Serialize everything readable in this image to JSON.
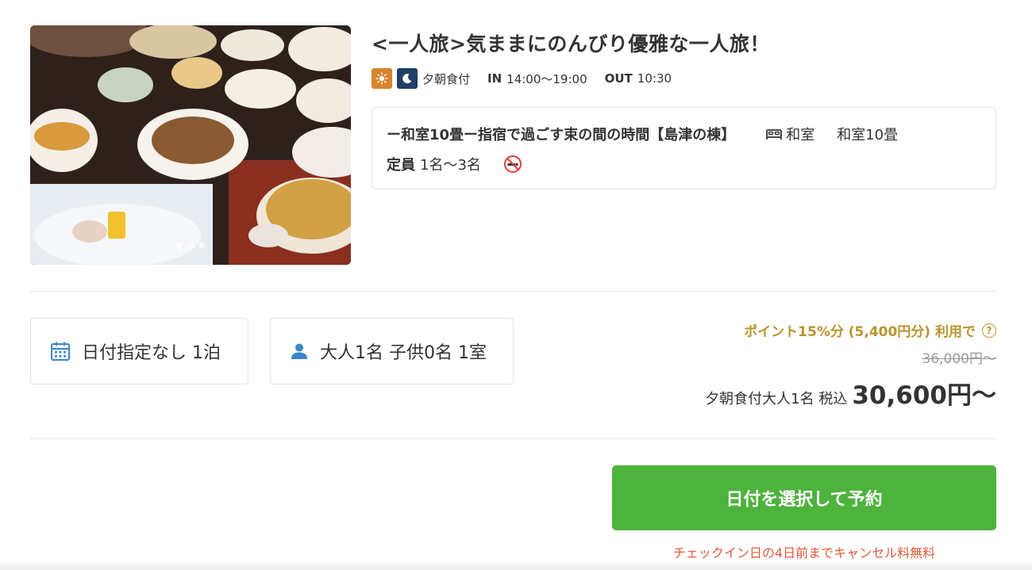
{
  "plan": {
    "title": "<一人旅>気ままにのんびり優雅な一人旅！",
    "image_alt": "会席料理の写真",
    "carousel": {
      "total": 3,
      "active": 1
    },
    "meal_label": "夕朝食付",
    "checkin_key": "IN",
    "checkin_val": "14:00〜19:00",
    "checkout_key": "OUT",
    "checkout_val": "10:30"
  },
  "room": {
    "name": "ー和室10畳ー指宿で過ごす束の間の時間【島津の棟】",
    "type": "和室",
    "size": "和室10畳",
    "capacity_label": "定員",
    "capacity_val": "1名〜3名",
    "smoking_icon": "no-smoking-icon"
  },
  "search": {
    "date_label": "日付指定なし 1泊",
    "guest_label": "大人1名 子供0名 1室"
  },
  "price": {
    "points_text": "ポイント15%分 (5,400円分) 利用で",
    "help_mark": "?",
    "original": "36,000円〜",
    "desc": "夕朝食付大人1名 税込",
    "main": "30,600円〜"
  },
  "cta": {
    "reserve_label": "日付を選択して予約",
    "cancel_note": "チェックイン日の4日前までキャンセル料無料"
  },
  "colors": {
    "accent_green": "#4db33d",
    "gold": "#b8952e",
    "cancel_red": "#e05a3a",
    "sun_badge": "#d9822b",
    "moon_badge": "#1f3f66",
    "icon_blue": "#3a86c8"
  }
}
